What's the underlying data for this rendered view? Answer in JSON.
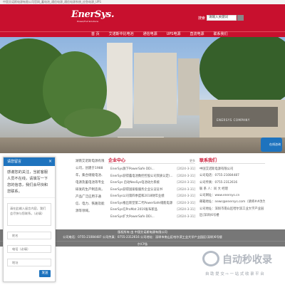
{
  "topbar": {
    "text": "中国艾诺斯电源有限公司官网_蓄电池_通信电源_通信电源系统_应急电源_UPS"
  },
  "header": {
    "brand": "EnerSys.",
    "tagline": "Power/Full Solutions",
    "search_label": "搜索",
    "search_value": "请输入关键词"
  },
  "nav": {
    "items": [
      "首 页",
      "艾诺斯中比电池",
      "通信电源",
      "UPS电源",
      "直流电源",
      "联系我们"
    ]
  },
  "hero": {
    "sign_text": "ENERSYS COMPANY"
  },
  "chat_widget": {
    "label": "在线咨询"
  },
  "about": {
    "text": "湖南艾诺斯电源有限公司，创建于1988年，集合储能电池、电源及蓄电池等专业研发的生产制造商，产品广泛应用于通信、电力、铁路及能源等领域。"
  },
  "news": {
    "title": "企业中心",
    "more": "更多",
    "items": [
      {
        "title": "EnerSys旗下PowerSafe DDi...",
        "date": "[2024-3-31]"
      },
      {
        "title": "EnerSys获得蓄电池数控控股公司资质认定(...",
        "date": "[2024-3-31]"
      },
      {
        "title": "EnerSys 启动NexSys电池动力系统",
        "date": "[2024-3-31]"
      },
      {
        "title": "EnerSys获得国家级服务企业认证证书",
        "date": "[2024-3-31]"
      },
      {
        "title": "EnerSys公司第四季度和2018财年业绩",
        "date": "[2024-3-31]"
      },
      {
        "title": "EnerSys推出新型第二代PowerSafe储能电源",
        "date": "[2024-3-31]"
      },
      {
        "title": "EnerSys在ProMat 2019发布新品",
        "date": "[2024-3-31]"
      },
      {
        "title": "EnerSys扩大PowerSafe DDi...",
        "date": "[2024-3-31]"
      }
    ]
  },
  "contact": {
    "title": "联系我们",
    "lines": [
      "中国艾诺斯电源有限公司",
      "公司电话：0755-21084487",
      "公司传真：0755-2312616",
      "联 系 人：尚 大 经理",
      "公司网址：www.enersys.cn",
      "邮箱地址：news@enersys.com（请将##改为@）",
      "公司地址：深圳市南山区哈尔滨工业大学产业园",
      "区(深圳)6号楼"
    ]
  },
  "footer": {
    "line1": "版权所有 由 中国艾诺斯电源有限公司",
    "line2": "公司电话：0755-21084487  公司传真：0755-2312616  公司地址：深圳市南山区哈尔滨工业大学产业园区(深圳)6号楼",
    "line3": "京ICP备"
  },
  "chatbox": {
    "title": "请您留言",
    "close": "×",
    "intro": "感谢您的关注，当前客服人员不在线，请填写一下您的信息，我们会尽快和您联系。",
    "message_placeholder": "请在此输入留言内容，我们会尽快与您联系。（必填）",
    "name_placeholder": "姓名",
    "phone_placeholder": "电话（必填）",
    "address_placeholder": "地址",
    "send_label": "发送"
  },
  "watermark": {
    "big": "自动秒收录",
    "small": "自 助 提 交 ⇨ 一 站 式 收 录 平 台"
  }
}
